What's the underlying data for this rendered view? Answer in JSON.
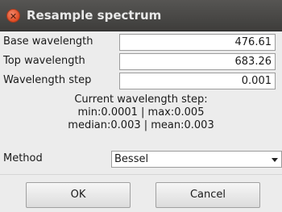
{
  "window": {
    "title": "Resample spectrum",
    "close_icon": "✕"
  },
  "fields": [
    {
      "label": "Base wavelength",
      "value": "476.61"
    },
    {
      "label": "Top wavelength",
      "value": "683.26"
    },
    {
      "label": "Wavelength step",
      "value": "0.001"
    }
  ],
  "info": {
    "line1": "Current wavelength step:",
    "line2": "min:0.0001 | max:0.005",
    "line3": "median:0.003 | mean:0.003"
  },
  "method": {
    "label": "Method",
    "selected": "Bessel"
  },
  "buttons": {
    "ok": "OK",
    "cancel": "Cancel"
  }
}
